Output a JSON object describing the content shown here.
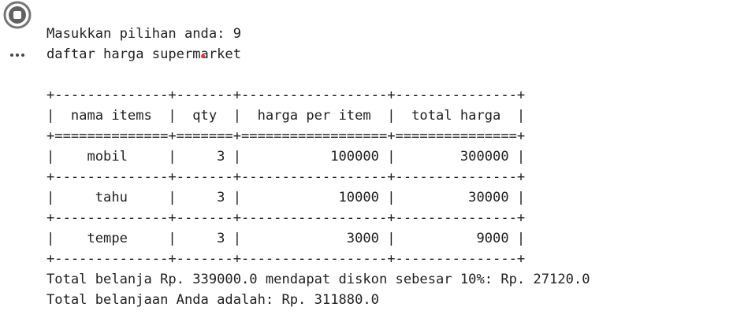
{
  "gutter": {
    "run_icon": "stop-circle-icon",
    "more_icon": "more-horizontal-icon"
  },
  "output": {
    "prompt_line": "Masukkan pilihan anda: 9",
    "heading_line": "daftar harga supermarket",
    "table": {
      "border_top": "+--------------+-------+------------------+---------------+",
      "header_row": "|  nama items  |  qty  |  harga per item  |  total harga  |",
      "header_separator": "+==============+=======+==================+===============+",
      "rows": [
        {
          "text": "|    mobil     |     3 |           100000 |        300000 |"
        },
        {
          "text": "|     tahu     |     3 |            10000 |         30000 |"
        },
        {
          "text": "|    tempe     |     3 |             3000 |          9000 |"
        }
      ],
      "row_separator": "+--------------+-------+------------------+---------------+"
    },
    "summary_line": "Total belanja Rp. 339000.0 mendapat diskon sebesar 10%: Rp. 27120.0",
    "total_line": "Total belanjaan Anda adalah: Rp. 311880.0"
  },
  "colors": {
    "text": "#212121",
    "icon": "#616161",
    "cursor_dot": "#e53935"
  }
}
